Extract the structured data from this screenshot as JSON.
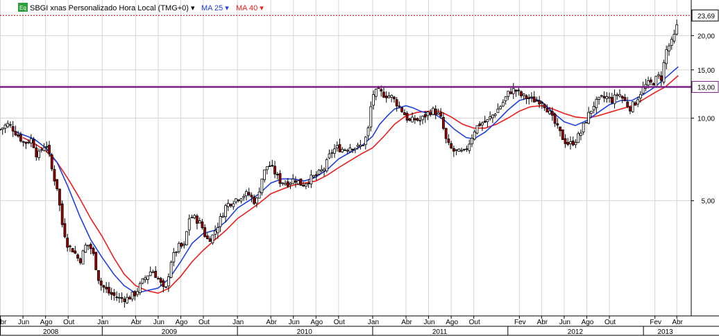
{
  "legend": {
    "badge": "Eq",
    "symbol_title": "SBGI xnas Personalizado Hora Local (TMG+0)",
    "ma25_label": "MA 25",
    "ma40_label": "MA 40",
    "dropdown_glyph": "▾"
  },
  "colors": {
    "background": "#ffffff",
    "grid": "#d4d4d4",
    "candle": "#000000",
    "candle_down_fill": "#a00000",
    "ma25": "#1f3fe0",
    "ma40": "#ee1c1c",
    "level_line": "#7a1f86",
    "last_price_line": "#b00000",
    "level_tag_text": "#c00000",
    "badge_bg": "#2e9e3e"
  },
  "chart_data": {
    "type": "candlestick",
    "title": "SBGI xnas Personalizado Hora Local (TMG+0)",
    "xlabel": "",
    "ylabel": "",
    "y_scale": "log",
    "ylim": [
      1.9,
      25.3
    ],
    "y_ticks": [
      5,
      10,
      15,
      20
    ],
    "y_tick_labels": [
      "5,00",
      "10,00",
      "15,00",
      "20,00"
    ],
    "last_price": 23.69,
    "last_price_label": "23,69",
    "horizontal_level": 13.0,
    "horizontal_level_label": "13,00",
    "x_range": [
      "2008-03-31",
      "2013-05-10"
    ],
    "month_ticks": [
      {
        "label": "Abr",
        "date": "2008-04-01"
      },
      {
        "label": "Jun",
        "date": "2008-06-01"
      },
      {
        "label": "Ago",
        "date": "2008-08-01"
      },
      {
        "label": "Out",
        "date": "2008-10-01"
      },
      {
        "label": "Jan",
        "date": "2009-01-01"
      },
      {
        "label": "Abr",
        "date": "2009-04-01"
      },
      {
        "label": "Jun",
        "date": "2009-06-01"
      },
      {
        "label": "Ago",
        "date": "2009-08-01"
      },
      {
        "label": "Out",
        "date": "2009-10-01"
      },
      {
        "label": "Jan",
        "date": "2010-01-01"
      },
      {
        "label": "Abr",
        "date": "2010-04-01"
      },
      {
        "label": "Jun",
        "date": "2010-06-01"
      },
      {
        "label": "Ago",
        "date": "2010-08-01"
      },
      {
        "label": "Out",
        "date": "2010-10-01"
      },
      {
        "label": "Jan",
        "date": "2011-01-01"
      },
      {
        "label": "Abr",
        "date": "2011-04-01"
      },
      {
        "label": "Jun",
        "date": "2011-06-01"
      },
      {
        "label": "Ago",
        "date": "2011-08-01"
      },
      {
        "label": "Out",
        "date": "2011-10-01"
      },
      {
        "label": "Fev",
        "date": "2012-02-01"
      },
      {
        "label": "Abr",
        "date": "2012-04-01"
      },
      {
        "label": "Jun",
        "date": "2012-06-01"
      },
      {
        "label": "Ago",
        "date": "2012-08-01"
      },
      {
        "label": "Out",
        "date": "2012-10-01"
      },
      {
        "label": "Fev",
        "date": "2013-02-01"
      },
      {
        "label": "Abr",
        "date": "2013-04-01"
      }
    ],
    "year_labels": [
      {
        "label": "2008",
        "date": "2008-08-15"
      },
      {
        "label": "2009",
        "date": "2009-07-01"
      },
      {
        "label": "2010",
        "date": "2010-07-01"
      },
      {
        "label": "2011",
        "date": "2011-07-01"
      },
      {
        "label": "2012",
        "date": "2012-07-01"
      },
      {
        "label": "2013",
        "date": "2013-03-01"
      }
    ],
    "year_boundaries": [
      "2009-01-01",
      "2010-01-01",
      "2011-01-01",
      "2012-01-01",
      "2013-01-01"
    ],
    "price_path": [
      [
        "2008-03-31",
        9.1
      ],
      [
        "2008-04-20",
        9.5
      ],
      [
        "2008-05-01",
        9.3
      ],
      [
        "2008-05-20",
        8.6
      ],
      [
        "2008-06-05",
        8.1
      ],
      [
        "2008-06-25",
        8.4
      ],
      [
        "2008-07-10",
        7.2
      ],
      [
        "2008-07-25",
        7.9
      ],
      [
        "2008-08-05",
        8.0
      ],
      [
        "2008-08-20",
        6.3
      ],
      [
        "2008-09-01",
        5.6
      ],
      [
        "2008-09-15",
        4.1
      ],
      [
        "2008-10-01",
        3.4
      ],
      [
        "2008-10-15",
        3.3
      ],
      [
        "2008-11-01",
        3.0
      ],
      [
        "2008-11-20",
        3.5
      ],
      [
        "2008-12-05",
        3.3
      ],
      [
        "2008-12-25",
        2.5
      ],
      [
        "2009-01-20",
        2.3
      ],
      [
        "2009-02-15",
        2.2
      ],
      [
        "2009-03-10",
        2.2
      ],
      [
        "2009-04-01",
        2.3
      ],
      [
        "2009-04-25",
        2.6
      ],
      [
        "2009-05-15",
        2.8
      ],
      [
        "2009-06-01",
        2.6
      ],
      [
        "2009-06-20",
        2.3
      ],
      [
        "2009-07-05",
        3.0
      ],
      [
        "2009-07-25",
        3.4
      ],
      [
        "2009-08-10",
        3.4
      ],
      [
        "2009-08-25",
        4.4
      ],
      [
        "2009-09-10",
        4.3
      ],
      [
        "2009-09-25",
        4.1
      ],
      [
        "2009-10-10",
        3.6
      ],
      [
        "2009-10-25",
        3.7
      ],
      [
        "2009-11-10",
        4.1
      ],
      [
        "2009-12-01",
        4.8
      ],
      [
        "2009-12-20",
        5.0
      ],
      [
        "2010-01-10",
        5.2
      ],
      [
        "2010-01-30",
        5.3
      ],
      [
        "2010-02-20",
        4.9
      ],
      [
        "2010-03-10",
        6.2
      ],
      [
        "2010-03-25",
        6.8
      ],
      [
        "2010-04-10",
        6.4
      ],
      [
        "2010-04-25",
        5.9
      ],
      [
        "2010-05-15",
        5.8
      ],
      [
        "2010-06-05",
        6.0
      ],
      [
        "2010-06-25",
        5.7
      ],
      [
        "2010-07-15",
        6.0
      ],
      [
        "2010-08-05",
        6.2
      ],
      [
        "2010-08-25",
        6.6
      ],
      [
        "2010-09-10",
        7.5
      ],
      [
        "2010-09-25",
        7.8
      ],
      [
        "2010-10-15",
        7.7
      ],
      [
        "2010-11-05",
        7.9
      ],
      [
        "2010-11-25",
        7.8
      ],
      [
        "2010-12-10",
        8.2
      ],
      [
        "2010-12-20",
        9.1
      ],
      [
        "2010-12-31",
        12.2
      ],
      [
        "2011-01-15",
        12.5
      ],
      [
        "2011-02-01",
        12.2
      ],
      [
        "2011-02-20",
        12.0
      ],
      [
        "2011-03-10",
        11.2
      ],
      [
        "2011-03-25",
        10.5
      ],
      [
        "2011-04-10",
        9.7
      ],
      [
        "2011-04-25",
        9.9
      ],
      [
        "2011-05-10",
        9.8
      ],
      [
        "2011-05-25",
        10.3
      ],
      [
        "2011-06-10",
        10.7
      ],
      [
        "2011-06-25",
        10.4
      ],
      [
        "2011-07-05",
        9.9
      ],
      [
        "2011-07-20",
        8.1
      ],
      [
        "2011-08-05",
        7.6
      ],
      [
        "2011-08-20",
        7.5
      ],
      [
        "2011-09-05",
        7.5
      ],
      [
        "2011-09-20",
        8.2
      ],
      [
        "2011-10-05",
        9.2
      ],
      [
        "2011-10-20",
        9.6
      ],
      [
        "2011-11-05",
        9.7
      ],
      [
        "2011-11-25",
        10.4
      ],
      [
        "2011-12-15",
        11.2
      ],
      [
        "2012-01-05",
        12.5
      ],
      [
        "2012-01-20",
        12.7
      ],
      [
        "2012-02-05",
        12.1
      ],
      [
        "2012-02-25",
        11.8
      ],
      [
        "2012-03-15",
        11.6
      ],
      [
        "2012-04-01",
        11.6
      ],
      [
        "2012-04-15",
        10.9
      ],
      [
        "2012-05-01",
        9.9
      ],
      [
        "2012-05-15",
        9.1
      ],
      [
        "2012-06-01",
        8.3
      ],
      [
        "2012-06-15",
        8.0
      ],
      [
        "2012-07-01",
        8.3
      ],
      [
        "2012-07-15",
        8.8
      ],
      [
        "2012-08-01",
        10.0
      ],
      [
        "2012-08-20",
        11.2
      ],
      [
        "2012-09-10",
        11.8
      ],
      [
        "2012-09-25",
        11.9
      ],
      [
        "2012-10-10",
        11.6
      ],
      [
        "2012-10-25",
        12.4
      ],
      [
        "2012-11-10",
        11.6
      ],
      [
        "2012-11-25",
        10.9
      ],
      [
        "2012-12-10",
        11.4
      ],
      [
        "2012-12-25",
        12.5
      ],
      [
        "2013-01-10",
        13.3
      ],
      [
        "2013-01-25",
        13.4
      ],
      [
        "2013-02-10",
        14.2
      ],
      [
        "2013-02-20",
        14.0
      ],
      [
        "2013-03-01",
        17.4
      ],
      [
        "2013-03-10",
        18.3
      ],
      [
        "2013-03-20",
        19.0
      ],
      [
        "2013-03-31",
        21.0
      ],
      [
        "2013-04-05",
        23.69
      ]
    ],
    "series": [
      {
        "name": "MA 25",
        "values": [
          [
            "2008-05-05",
            9.0
          ],
          [
            "2008-06-01",
            8.7
          ],
          [
            "2008-07-01",
            8.4
          ],
          [
            "2008-08-01",
            7.8
          ],
          [
            "2008-09-01",
            6.9
          ],
          [
            "2008-10-01",
            5.6
          ],
          [
            "2008-11-01",
            4.4
          ],
          [
            "2008-12-01",
            3.6
          ],
          [
            "2009-01-01",
            3.1
          ],
          [
            "2009-02-01",
            2.7
          ],
          [
            "2009-03-01",
            2.45
          ],
          [
            "2009-04-01",
            2.3
          ],
          [
            "2009-05-01",
            2.35
          ],
          [
            "2009-06-01",
            2.4
          ],
          [
            "2009-07-01",
            2.6
          ],
          [
            "2009-08-01",
            3.0
          ],
          [
            "2009-09-01",
            3.5
          ],
          [
            "2009-10-01",
            3.8
          ],
          [
            "2009-11-01",
            3.9
          ],
          [
            "2009-12-01",
            4.2
          ],
          [
            "2010-01-01",
            4.7
          ],
          [
            "2010-02-01",
            5.0
          ],
          [
            "2010-03-01",
            5.3
          ],
          [
            "2010-04-01",
            5.8
          ],
          [
            "2010-05-01",
            6.0
          ],
          [
            "2010-06-01",
            6.0
          ],
          [
            "2010-07-01",
            5.9
          ],
          [
            "2010-08-01",
            6.1
          ],
          [
            "2010-09-01",
            6.5
          ],
          [
            "2010-10-01",
            7.1
          ],
          [
            "2010-11-01",
            7.5
          ],
          [
            "2010-12-01",
            7.9
          ],
          [
            "2011-01-01",
            8.6
          ],
          [
            "2011-01-20",
            9.5
          ],
          [
            "2011-02-10",
            10.2
          ],
          [
            "2011-03-01",
            10.8
          ],
          [
            "2011-04-01",
            11.1
          ],
          [
            "2011-04-20",
            10.9
          ],
          [
            "2011-05-10",
            10.6
          ],
          [
            "2011-06-01",
            10.4
          ],
          [
            "2011-06-20",
            10.3
          ],
          [
            "2011-07-15",
            9.8
          ],
          [
            "2011-08-10",
            9.1
          ],
          [
            "2011-09-10",
            8.5
          ],
          [
            "2011-10-01",
            8.4
          ],
          [
            "2011-11-01",
            8.9
          ],
          [
            "2011-12-01",
            9.7
          ],
          [
            "2012-01-01",
            10.7
          ],
          [
            "2012-02-01",
            11.6
          ],
          [
            "2012-03-01",
            11.9
          ],
          [
            "2012-04-01",
            11.5
          ],
          [
            "2012-05-01",
            10.5
          ],
          [
            "2012-06-01",
            9.7
          ],
          [
            "2012-07-01",
            9.4
          ],
          [
            "2012-08-01",
            9.8
          ],
          [
            "2012-09-01",
            10.5
          ],
          [
            "2012-10-01",
            11.2
          ],
          [
            "2012-11-01",
            11.6
          ],
          [
            "2012-12-01",
            11.6
          ],
          [
            "2013-01-01",
            12.2
          ],
          [
            "2013-02-01",
            13.0
          ],
          [
            "2013-03-01",
            14.0
          ],
          [
            "2013-04-05",
            15.4
          ]
        ]
      },
      {
        "name": "MA 40",
        "values": [
          [
            "2008-06-01",
            8.5
          ],
          [
            "2008-07-01",
            8.1
          ],
          [
            "2008-08-01",
            7.6
          ],
          [
            "2008-09-01",
            6.9
          ],
          [
            "2008-10-01",
            6.0
          ],
          [
            "2008-11-01",
            5.1
          ],
          [
            "2008-12-01",
            4.3
          ],
          [
            "2009-01-01",
            3.7
          ],
          [
            "2009-02-01",
            3.1
          ],
          [
            "2009-03-01",
            2.7
          ],
          [
            "2009-04-01",
            2.45
          ],
          [
            "2009-05-01",
            2.35
          ],
          [
            "2009-06-01",
            2.3
          ],
          [
            "2009-07-01",
            2.4
          ],
          [
            "2009-08-01",
            2.65
          ],
          [
            "2009-09-01",
            3.0
          ],
          [
            "2009-10-01",
            3.3
          ],
          [
            "2009-11-01",
            3.6
          ],
          [
            "2009-12-01",
            3.9
          ],
          [
            "2010-01-01",
            4.3
          ],
          [
            "2010-02-01",
            4.6
          ],
          [
            "2010-03-01",
            4.9
          ],
          [
            "2010-04-01",
            5.3
          ],
          [
            "2010-05-01",
            5.5
          ],
          [
            "2010-06-01",
            5.7
          ],
          [
            "2010-07-01",
            5.8
          ],
          [
            "2010-08-01",
            5.9
          ],
          [
            "2010-09-01",
            6.2
          ],
          [
            "2010-10-01",
            6.6
          ],
          [
            "2010-11-01",
            7.0
          ],
          [
            "2010-12-01",
            7.4
          ],
          [
            "2011-01-01",
            7.8
          ],
          [
            "2011-02-01",
            8.6
          ],
          [
            "2011-03-01",
            9.5
          ],
          [
            "2011-04-01",
            10.2
          ],
          [
            "2011-05-01",
            10.5
          ],
          [
            "2011-06-01",
            10.6
          ],
          [
            "2011-07-01",
            10.6
          ],
          [
            "2011-08-01",
            10.1
          ],
          [
            "2011-09-01",
            9.5
          ],
          [
            "2011-10-01",
            9.2
          ],
          [
            "2011-11-01",
            9.2
          ],
          [
            "2011-12-01",
            9.5
          ],
          [
            "2012-01-01",
            10.0
          ],
          [
            "2012-02-01",
            10.6
          ],
          [
            "2012-03-01",
            11.0
          ],
          [
            "2012-04-01",
            11.1
          ],
          [
            "2012-05-01",
            10.8
          ],
          [
            "2012-06-01",
            10.4
          ],
          [
            "2012-07-01",
            10.1
          ],
          [
            "2012-08-01",
            10.0
          ],
          [
            "2012-09-01",
            10.2
          ],
          [
            "2012-10-01",
            10.5
          ],
          [
            "2012-11-01",
            10.8
          ],
          [
            "2012-12-01",
            11.1
          ],
          [
            "2013-01-01",
            11.7
          ],
          [
            "2013-02-01",
            12.4
          ],
          [
            "2013-03-01",
            13.0
          ],
          [
            "2013-04-05",
            14.3
          ]
        ]
      }
    ]
  }
}
